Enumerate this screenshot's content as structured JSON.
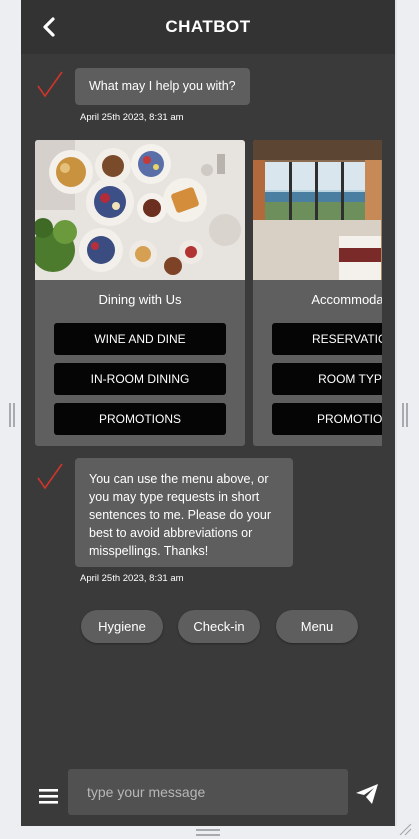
{
  "header": {
    "title": "CHATBOT"
  },
  "messages": [
    {
      "text": "What may I help you with?",
      "timestamp": "April 25th 2023, 8:31 am"
    },
    {
      "text": "You can use the menu above, or you may type requests in short sentences to me. Please do your best to avoid abbreviations or misspellings. Thanks!",
      "timestamp": "April 25th 2023, 8:31 am"
    }
  ],
  "cards": [
    {
      "title": "Dining with Us",
      "buttons": [
        "WINE AND DINE",
        "IN-ROOM DINING",
        "PROMOTIONS"
      ]
    },
    {
      "title": "Accommodation",
      "buttons": [
        "RESERVATIONS",
        "ROOM TYPES",
        "PROMOTIONS"
      ]
    }
  ],
  "quick_replies": [
    "Hygiene",
    "Check-in",
    "Menu"
  ],
  "composer": {
    "placeholder": "type your message"
  },
  "colors": {
    "background": "#3a3a3a",
    "header": "#333333",
    "bubble": "#5e5e5e",
    "check": "#d0342c"
  },
  "icons": {
    "back": "chevron-left-icon",
    "avatar": "check-mark-icon",
    "menu": "hamburger-icon",
    "send": "paper-plane-icon"
  }
}
